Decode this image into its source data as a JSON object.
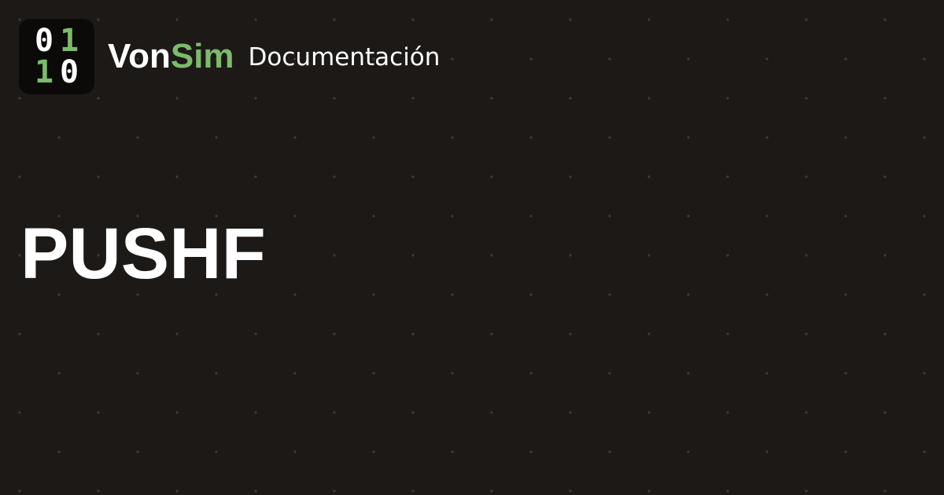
{
  "logo": {
    "bits": [
      "0",
      "1",
      "1",
      "0"
    ],
    "bit_colors": [
      "#ffffff",
      "#7cbb6b",
      "#7cbb6b",
      "#ffffff"
    ]
  },
  "brand": {
    "name_part1": "Von",
    "name_part2": "Sim",
    "subtitle": "Documentación",
    "accent_color": "#7cbb6b"
  },
  "page": {
    "title": "PUSHF",
    "background_color": "#1c1917"
  }
}
